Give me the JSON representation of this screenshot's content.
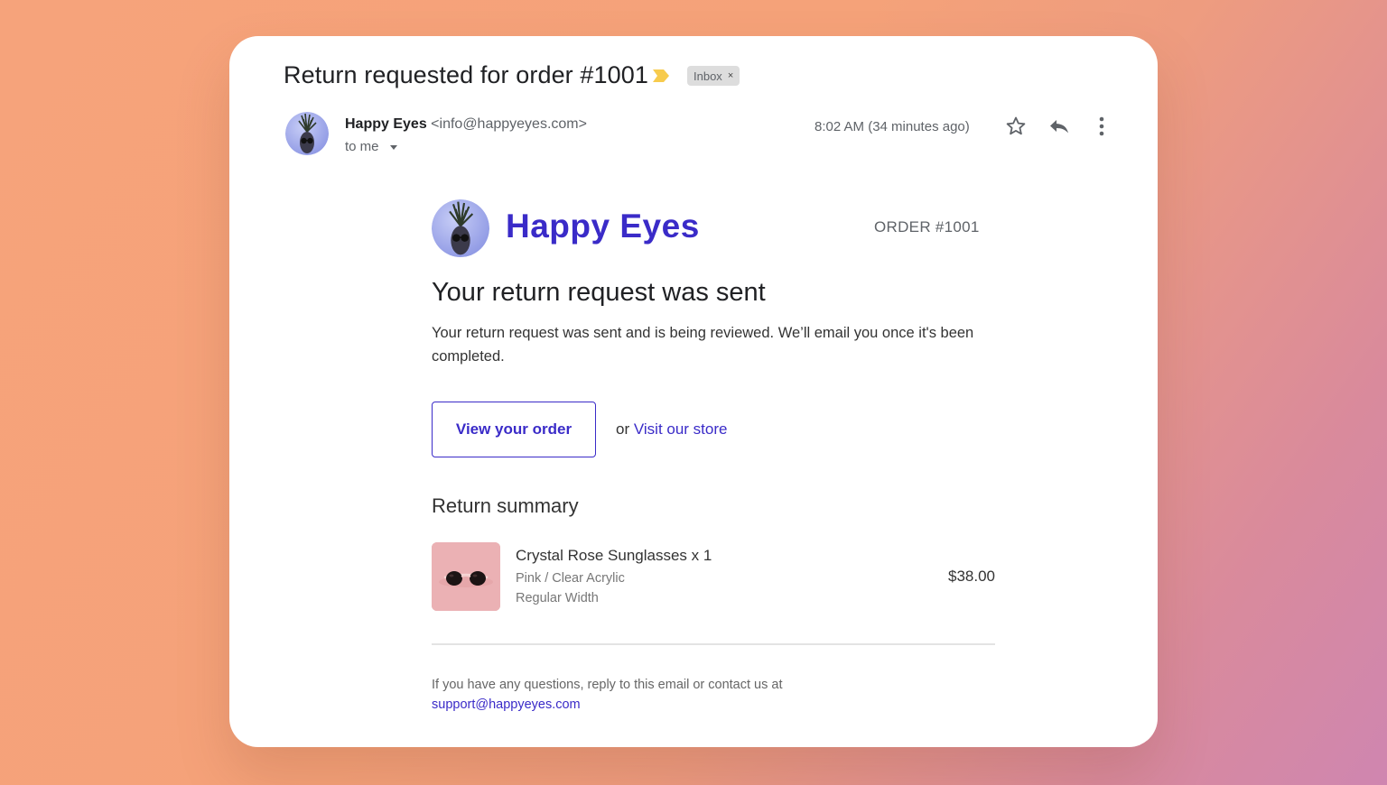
{
  "email": {
    "subject": "Return requested for order #1001",
    "label": "Inbox",
    "label_remove": "×",
    "sender_name": "Happy Eyes",
    "sender_email": "<info@happyeyes.com>",
    "recipient": "to me",
    "timestamp": "8:02 AM (34 minutes ago)",
    "importance_color": "#f7cb4d"
  },
  "icons": {
    "importance": "importance-marker-icon",
    "star": "star-icon",
    "reply": "reply-icon",
    "more": "more-vert-icon",
    "caret": "caret-down-icon"
  },
  "message": {
    "brand_name": "Happy Eyes",
    "brand_color": "#3a2bc8",
    "order_number": "ORDER #1001",
    "heading": "Your return request was sent",
    "body": "Your return request was sent and is being reviewed. We’ll email you once it's been completed.",
    "view_order_label": "View your order",
    "or_text": "or",
    "visit_store_label": "Visit our store",
    "summary_title": "Return summary",
    "items": [
      {
        "name": "Crystal Rose Sunglasses x 1",
        "variant": "Pink / Clear Acrylic",
        "width": "Regular Width",
        "price": "$38.00"
      }
    ],
    "footer_text": "If you have any questions, reply to this email or contact us at",
    "support_email": "support@happyeyes.com"
  }
}
